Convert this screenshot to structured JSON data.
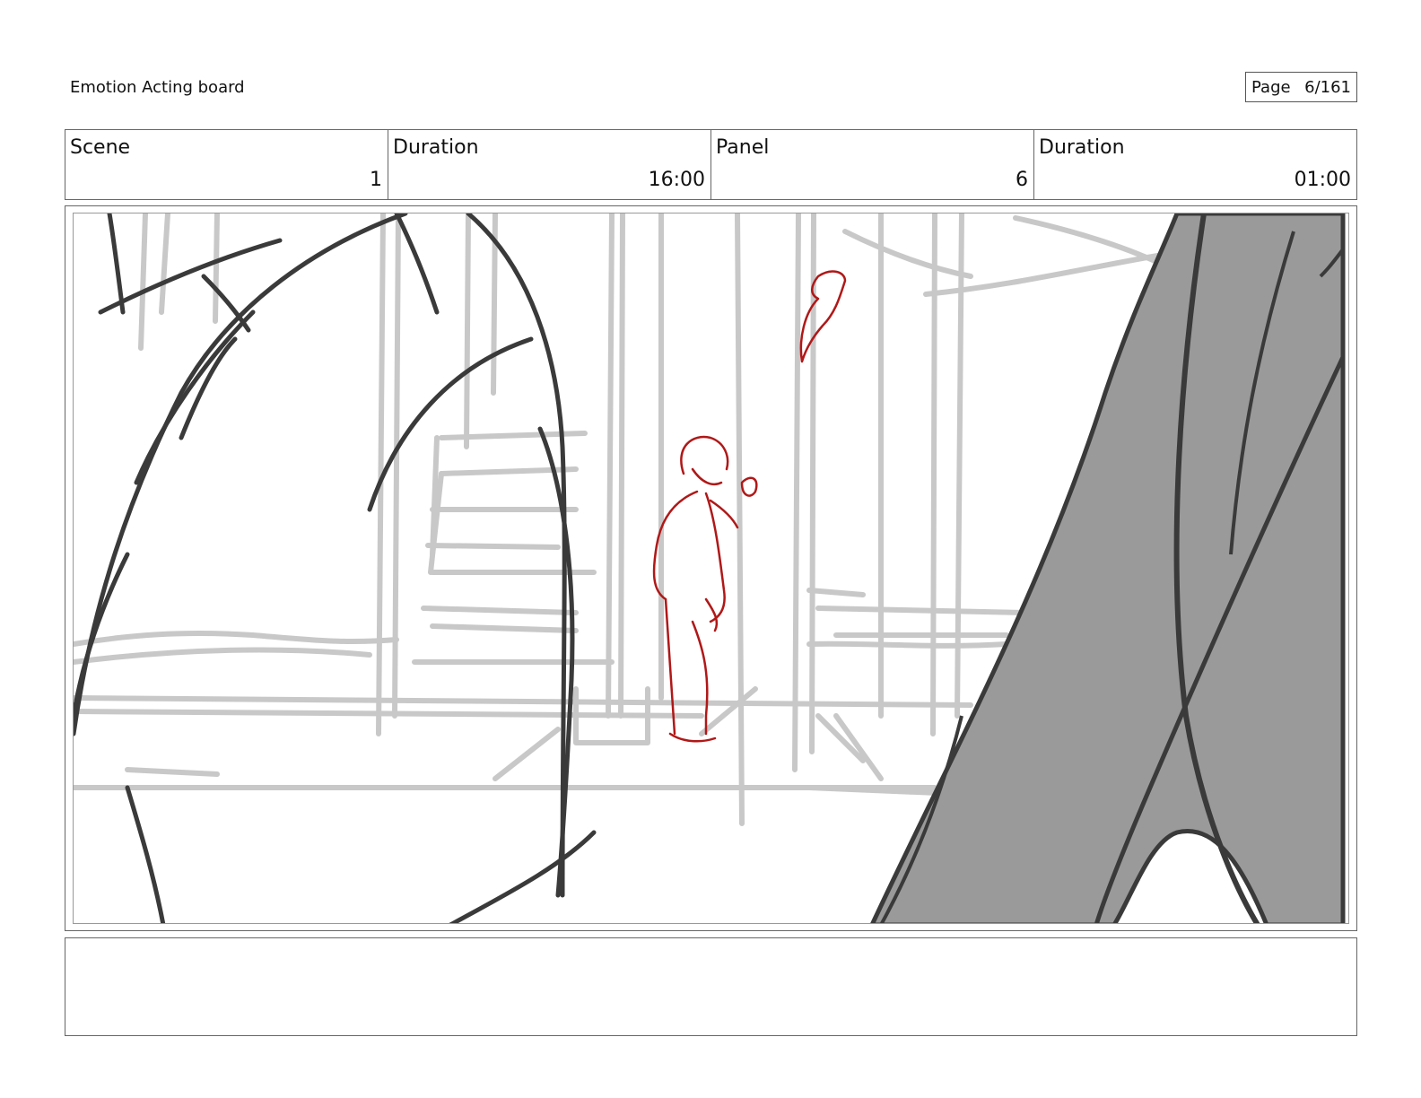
{
  "header": {
    "board_title": "Emotion Acting board",
    "page_label": "Page",
    "page_value": "6/161"
  },
  "info": [
    {
      "label": "Scene",
      "value": "1"
    },
    {
      "label": "Duration",
      "value": "16:00"
    },
    {
      "label": "Panel",
      "value": "6"
    },
    {
      "label": "Duration",
      "value": "01:00"
    }
  ],
  "notes": {
    "text": ""
  },
  "colors": {
    "rough_sketch": "#c8c8c8",
    "line_art": "#3a3a3a",
    "character": "#b01818",
    "shadow_fill": "#9a9a9a"
  }
}
